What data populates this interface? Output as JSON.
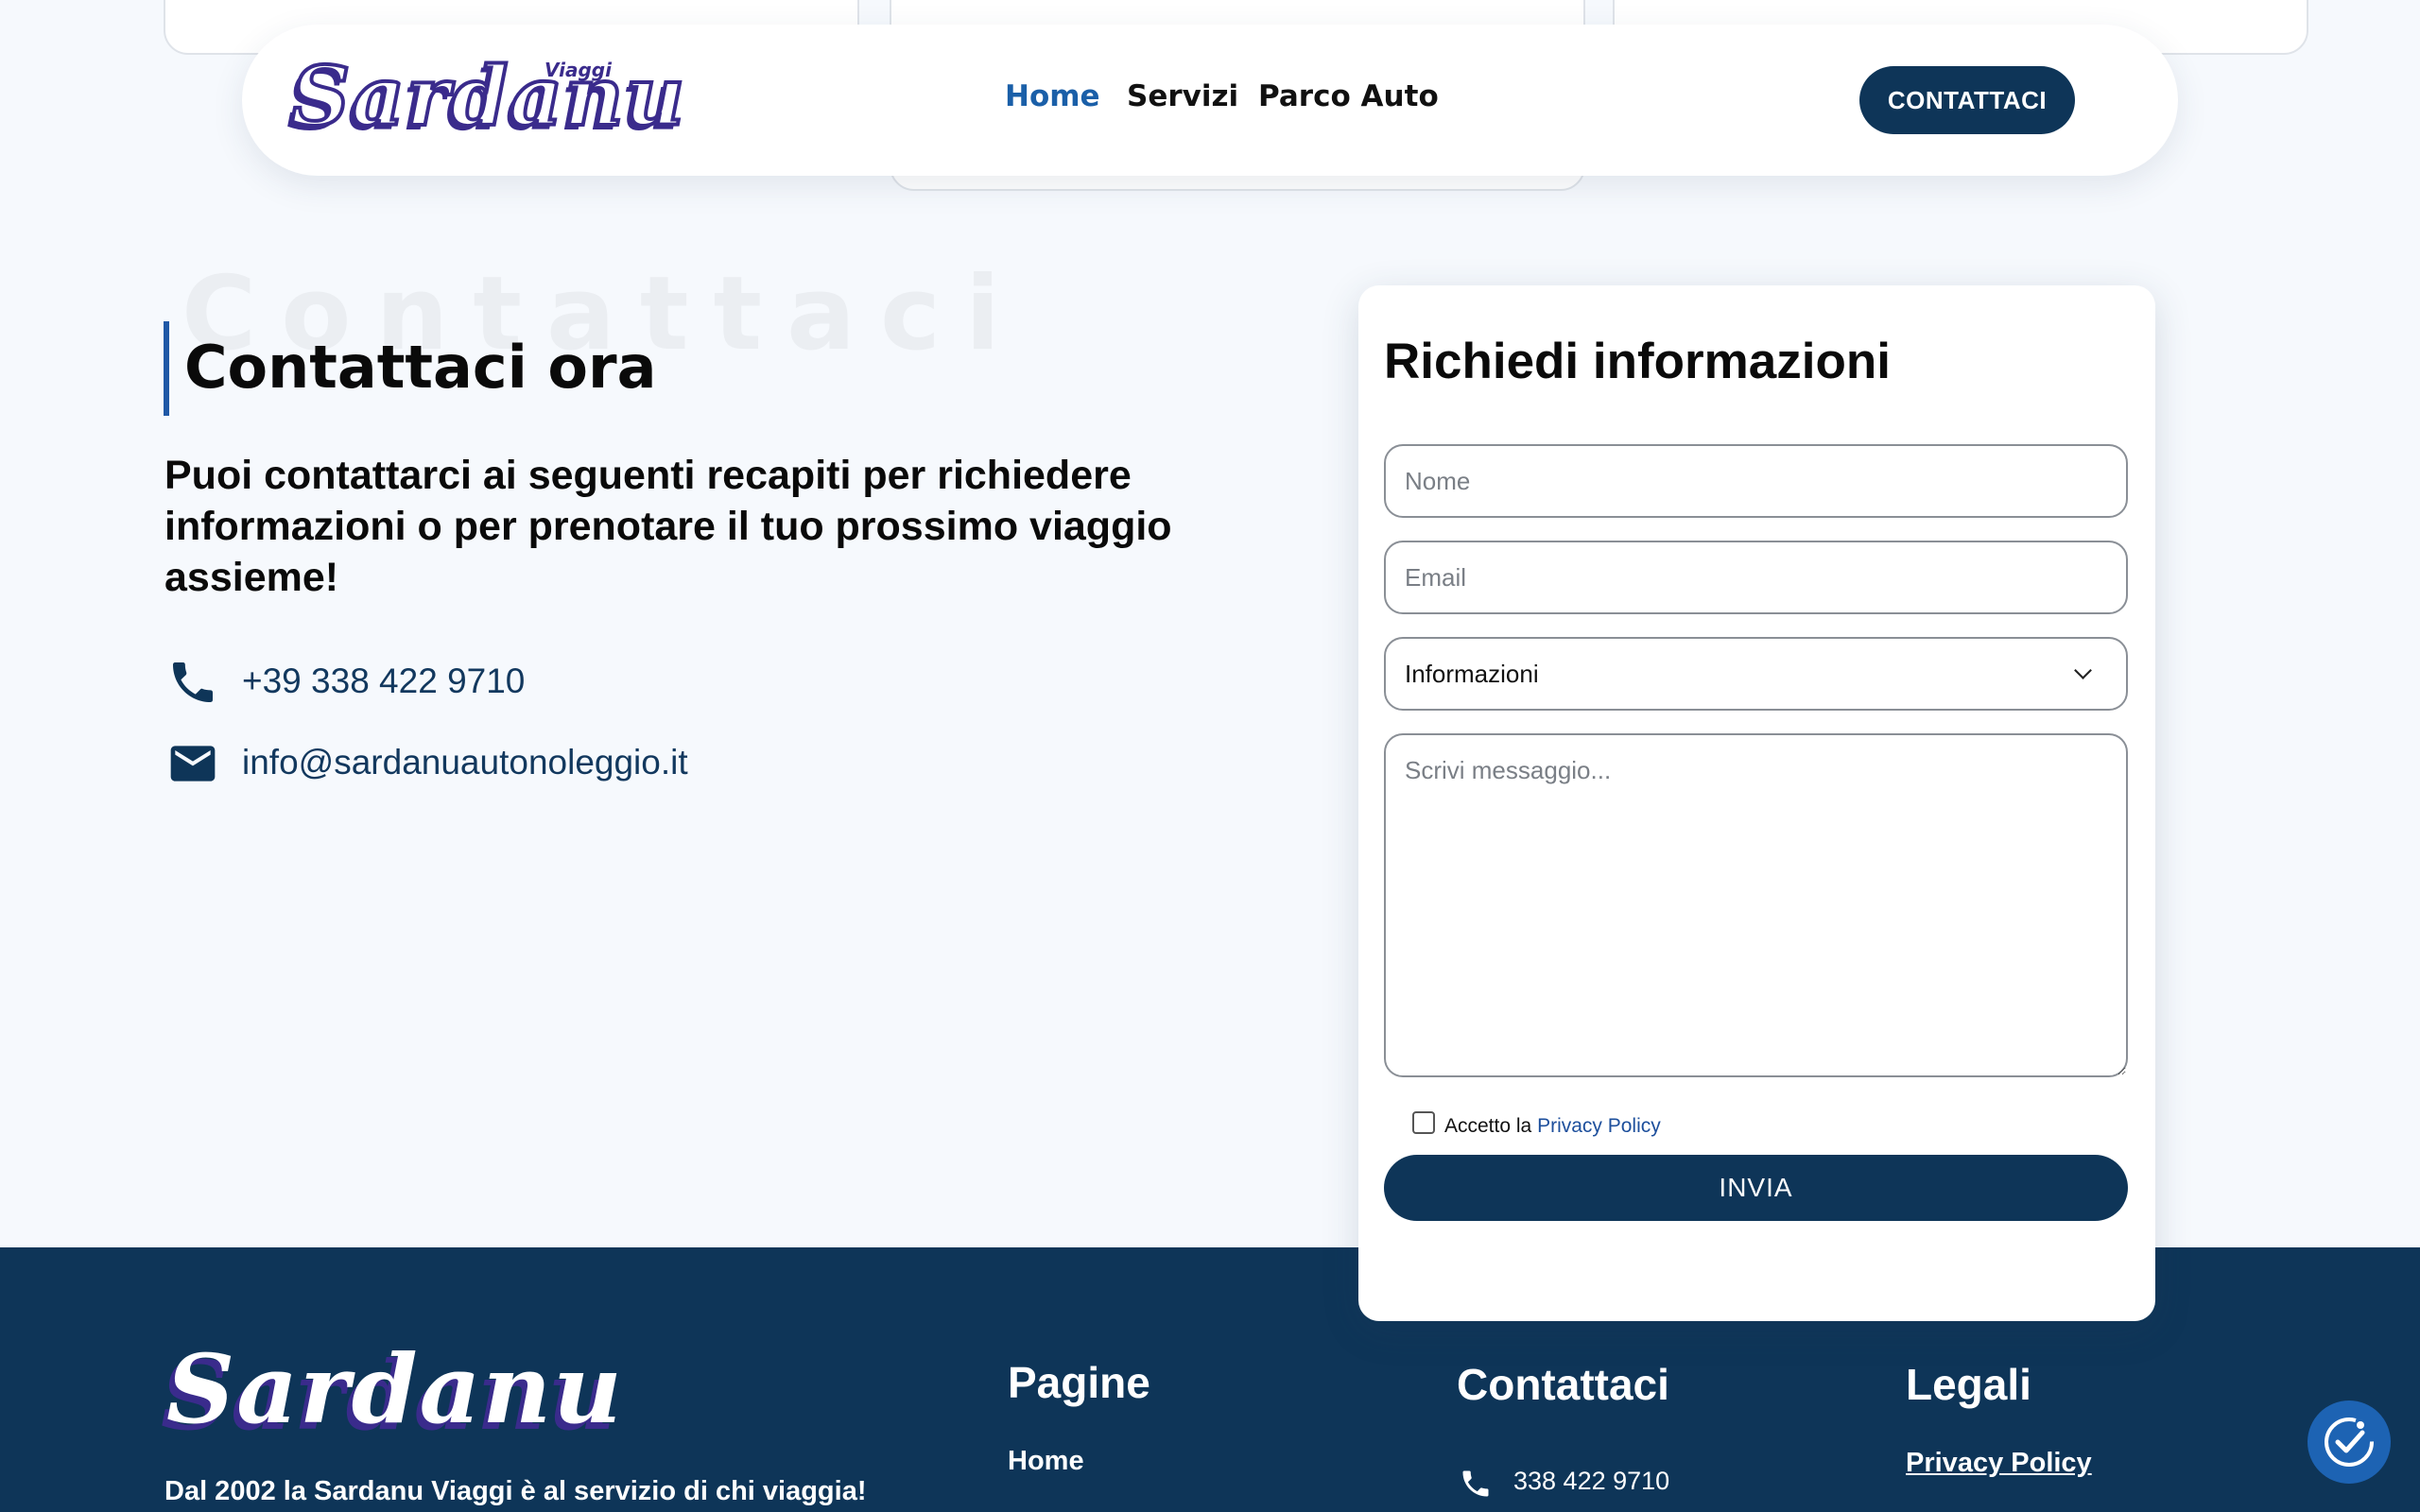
{
  "nav": {
    "logo_text": "Sardanu",
    "logo_sub": "Viaggi",
    "menu": [
      {
        "label": "Home",
        "active": true
      },
      {
        "label": "Servizi",
        "active": false
      },
      {
        "label": "Parco Auto",
        "active": false
      }
    ],
    "cta_label": "CONTATTACI"
  },
  "contact": {
    "ghost_title": "Contattaci",
    "title": "Contattaci ora",
    "lead": "Puoi contattarci ai seguenti recapiti per richiedere informazioni o per prenotare il tuo prossimo viaggio assieme!",
    "phone": "+39 338 422 9710",
    "email": "info@sardanuautonoleggio.it",
    "phone_icon": "phone-icon",
    "email_icon": "mail-icon"
  },
  "form": {
    "title": "Richiedi informazioni",
    "name_placeholder": "Nome",
    "email_placeholder": "Email",
    "subject_value": "Informazioni",
    "message_placeholder": "Scrivi messaggio...",
    "consent_prefix": "Accetto la",
    "consent_link": "Privacy Policy",
    "consent_checked": false,
    "submit_label": "INVIA"
  },
  "footer": {
    "logo_text": "Sardanu",
    "tagline": "Dal 2002 la Sardanu Viaggi è al servizio di chi viaggia!",
    "pages_title": "Pagine",
    "pages_links": [
      "Home"
    ],
    "contacts_title": "Contattaci",
    "contacts_phone": "338 422 9710",
    "legal_title": "Legali",
    "legal_links": [
      "Privacy Policy"
    ]
  },
  "accessibility_button_icon": "accessibility-icon",
  "colors": {
    "primary": "#0e3558",
    "accent_blue": "#1a5fa8",
    "logo_purple": "#3a2b8c",
    "background": "#f6f9fd"
  }
}
